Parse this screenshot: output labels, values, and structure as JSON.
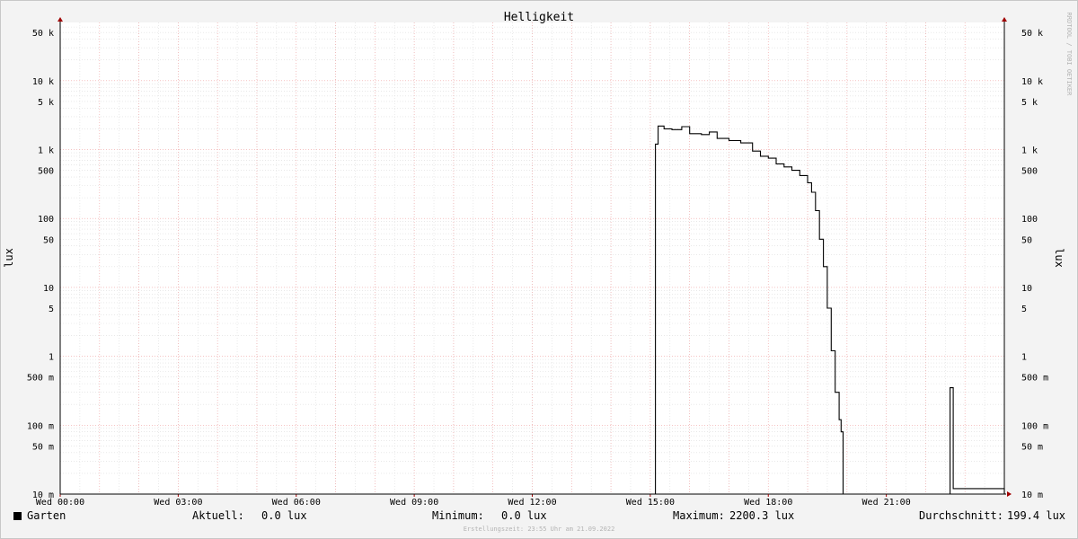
{
  "chart_data": {
    "type": "line",
    "title": "Helligkeit",
    "ylabel": "lux",
    "watermark": "RRDTOOL / TOBI OETIKER",
    "y_scale": "log",
    "ylim": [
      0.01,
      70000
    ],
    "y_ticks": [
      {
        "v": 50000,
        "label": "50 k"
      },
      {
        "v": 10000,
        "label": "10 k"
      },
      {
        "v": 5000,
        "label": "5 k"
      },
      {
        "v": 1000,
        "label": "1 k"
      },
      {
        "v": 500,
        "label": "500"
      },
      {
        "v": 100,
        "label": "100"
      },
      {
        "v": 50,
        "label": "50"
      },
      {
        "v": 10,
        "label": "10"
      },
      {
        "v": 5,
        "label": "5"
      },
      {
        "v": 1,
        "label": "1"
      },
      {
        "v": 0.5,
        "label": "500 m"
      },
      {
        "v": 0.1,
        "label": "100 m"
      },
      {
        "v": 0.05,
        "label": "50 m"
      },
      {
        "v": 0.01,
        "label": "10 m"
      }
    ],
    "xlim": [
      0,
      24
    ],
    "x_ticks": [
      {
        "v": 0,
        "label": "Wed 00:00"
      },
      {
        "v": 3,
        "label": "Wed 03:00"
      },
      {
        "v": 6,
        "label": "Wed 06:00"
      },
      {
        "v": 9,
        "label": "Wed 09:00"
      },
      {
        "v": 12,
        "label": "Wed 12:00"
      },
      {
        "v": 15,
        "label": "Wed 15:00"
      },
      {
        "v": 18,
        "label": "Wed 18:00"
      },
      {
        "v": 21,
        "label": "Wed 21:00"
      }
    ],
    "series": [
      {
        "name": "Garten",
        "color": "#000000",
        "points": [
          [
            0,
            0.01
          ],
          [
            15.13,
            0.01
          ],
          [
            15.13,
            1200
          ],
          [
            15.2,
            2200
          ],
          [
            15.35,
            2000
          ],
          [
            15.55,
            1950
          ],
          [
            15.8,
            2150
          ],
          [
            16.0,
            1700
          ],
          [
            16.3,
            1650
          ],
          [
            16.5,
            1800
          ],
          [
            16.7,
            1450
          ],
          [
            17.0,
            1350
          ],
          [
            17.3,
            1250
          ],
          [
            17.6,
            950
          ],
          [
            17.8,
            800
          ],
          [
            18.0,
            750
          ],
          [
            18.2,
            620
          ],
          [
            18.4,
            560
          ],
          [
            18.6,
            500
          ],
          [
            18.8,
            420
          ],
          [
            19.0,
            330
          ],
          [
            19.1,
            240
          ],
          [
            19.2,
            130
          ],
          [
            19.3,
            50
          ],
          [
            19.4,
            20
          ],
          [
            19.5,
            5
          ],
          [
            19.6,
            1.2
          ],
          [
            19.7,
            0.3
          ],
          [
            19.8,
            0.12
          ],
          [
            19.85,
            0.08
          ],
          [
            19.9,
            0.01
          ],
          [
            22.6,
            0.01
          ],
          [
            22.62,
            0.35
          ],
          [
            22.68,
            0.35
          ],
          [
            22.7,
            0.012
          ],
          [
            24,
            0.01
          ]
        ]
      }
    ]
  },
  "legend": {
    "series_name": "Garten",
    "aktuell_label": "Aktuell:",
    "aktuell_value": "0.0 lux",
    "minimum_label": "Minimum:",
    "minimum_value": "0.0 lux",
    "maximum_label": "Maximum:",
    "maximum_value": "2200.3 lux",
    "durchschnitt_label": "Durchschnitt:",
    "durchschnitt_value": "199.4 lux"
  },
  "footer": "Erstellungszeit: 23:55 Uhr am 21.09.2022"
}
